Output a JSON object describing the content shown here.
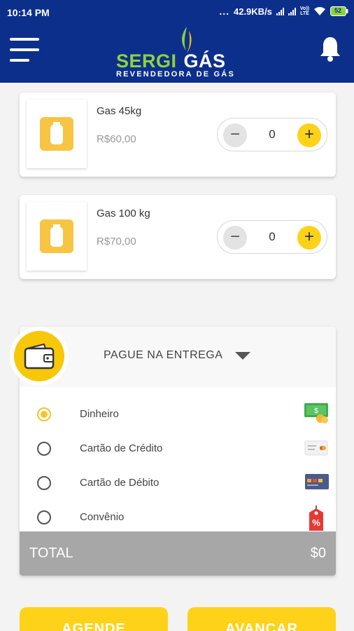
{
  "status_bar": {
    "time": "10:14 PM",
    "dots": "...",
    "net_speed": "42.9KB/s",
    "volte_top": "Vo))",
    "volte_bottom": "LTE",
    "battery": "52"
  },
  "app_bar": {
    "logo_part1": "SERGI",
    "logo_part2": "GÁS",
    "logo_subtitle": "REVENDEDORA DE GÁS",
    "icons": {
      "menu": "hamburger-menu-icon",
      "notifications": "bell-icon"
    }
  },
  "products": [
    {
      "name": "Gas 45kg",
      "price": "R$60,00",
      "quantity": "0",
      "icon": "gas-cylinder-icon"
    },
    {
      "name": "Gas 100 kg",
      "price": "R$70,00",
      "quantity": "0",
      "icon": "gas-cylinder-icon"
    }
  ],
  "stepper": {
    "minus": "−",
    "plus": "+"
  },
  "payment": {
    "selected_method": "PAGUE NA ENTREGA",
    "icon": "wallet-icon",
    "options": [
      {
        "label": "Dinheiro",
        "selected": true,
        "icon": "cash-icon"
      },
      {
        "label": "Cartão de Crédito",
        "selected": false,
        "icon": "credit-card-icon"
      },
      {
        "label": "Cartão de Débito",
        "selected": false,
        "icon": "debit-card-icon"
      },
      {
        "label": "Convênio",
        "selected": false,
        "icon": "discount-tag-icon"
      }
    ],
    "total_label": "TOTAL",
    "total_value": "$0"
  },
  "buttons": {
    "schedule": "AGENDE",
    "next": "AVANÇAR"
  },
  "colors": {
    "primary": "#0d2f8c",
    "accent": "#ffd21a",
    "total_bar": "#a7a7a7",
    "logo_green": "#8bd43d"
  }
}
